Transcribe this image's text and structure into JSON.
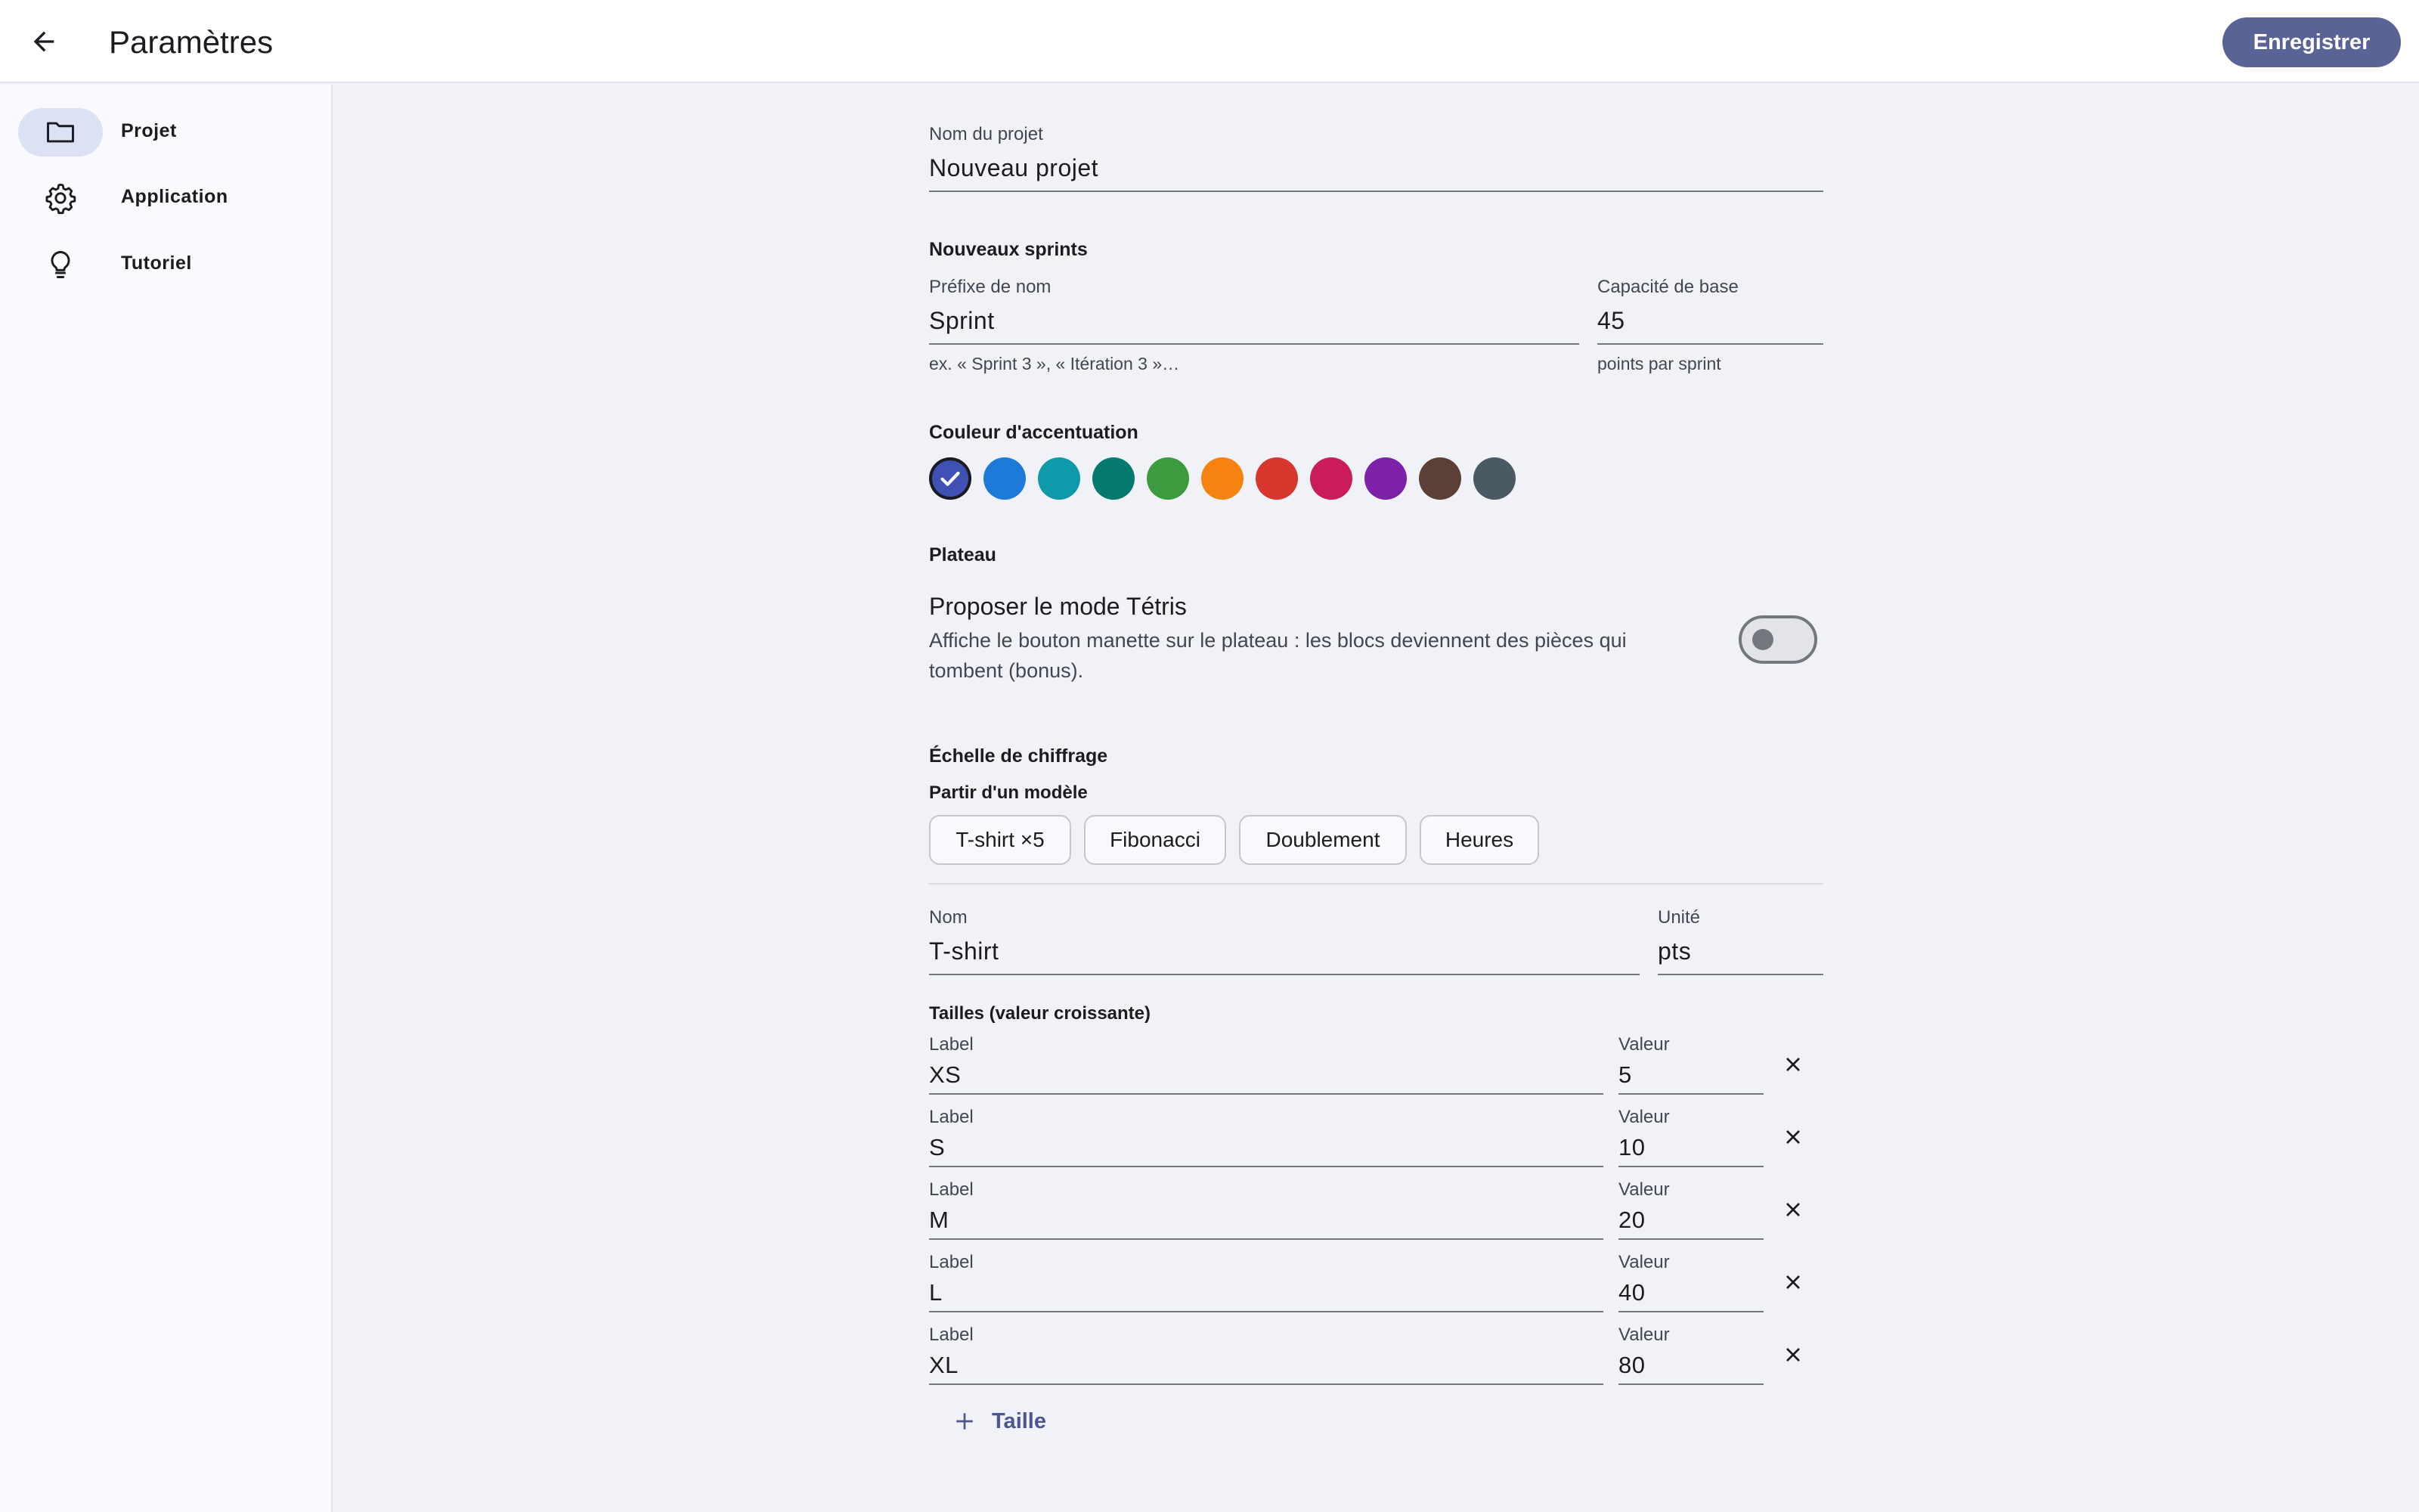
{
  "header": {
    "title": "Paramètres",
    "save_label": "Enregistrer"
  },
  "sidebar": {
    "items": [
      {
        "label": "Projet",
        "icon": "folder-icon",
        "active": true
      },
      {
        "label": "Application",
        "icon": "gear-icon",
        "active": false
      },
      {
        "label": "Tutoriel",
        "icon": "lightbulb-icon",
        "active": false
      }
    ]
  },
  "project": {
    "name_label": "Nom du projet",
    "name_value": "Nouveau projet"
  },
  "sprints": {
    "title": "Nouveaux sprints",
    "prefix_label": "Préfixe de nom",
    "prefix_value": "Sprint",
    "prefix_helper": "ex. « Sprint 3 », « Itération 3 »…",
    "capacity_label": "Capacité de base",
    "capacity_value": "45",
    "capacity_helper": "points par sprint"
  },
  "accent": {
    "title": "Couleur d'accentuation",
    "colors": [
      "#3f51b5",
      "#1e7ad8",
      "#0e9aab",
      "#047a6e",
      "#3c9a3f",
      "#f5830f",
      "#d8372e",
      "#ca1c5c",
      "#7d21a8",
      "#5c4037",
      "#4a5a64"
    ],
    "selected_index": 0
  },
  "board": {
    "title": "Plateau",
    "tetris_title": "Proposer le mode Tétris",
    "tetris_desc_line1": "Affiche le bouton manette sur le plateau : les blocs deviennent des pièces qui",
    "tetris_desc_line2": "tombent (bonus).",
    "tetris_enabled": false
  },
  "scale": {
    "title": "Échelle de chiffrage",
    "template_title": "Partir d'un modèle",
    "templates": [
      "T-shirt ×5",
      "Fibonacci",
      "Doublement",
      "Heures"
    ],
    "name_label": "Nom",
    "name_value": "T-shirt",
    "unit_label": "Unité",
    "unit_value": "pts",
    "sizes_title": "Tailles (valeur croissante)",
    "size_label_label": "Label",
    "size_value_label": "Valeur",
    "sizes": [
      {
        "label": "XS",
        "value": "5"
      },
      {
        "label": "S",
        "value": "10"
      },
      {
        "label": "M",
        "value": "20"
      },
      {
        "label": "L",
        "value": "40"
      },
      {
        "label": "XL",
        "value": "80"
      }
    ],
    "add_label": "Taille"
  }
}
